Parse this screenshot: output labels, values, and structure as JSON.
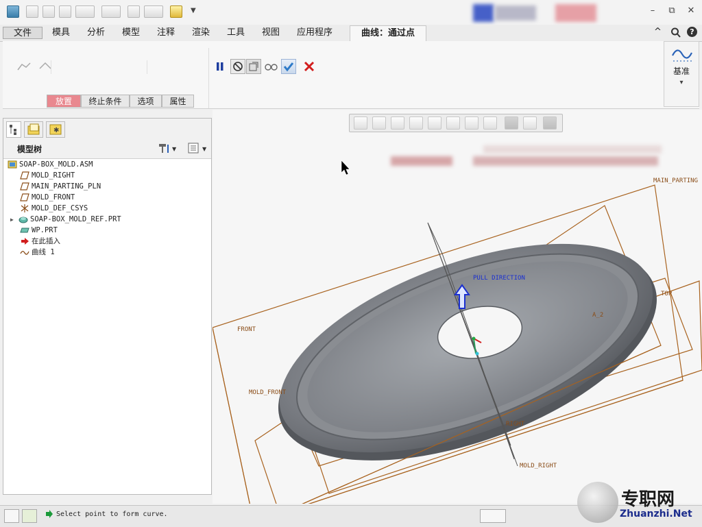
{
  "quick_access": {
    "dropdown": "▼"
  },
  "window": {
    "minimize": "–",
    "restore": "⧉",
    "close": "✕",
    "help": "?",
    "caret": "^"
  },
  "menu": {
    "file": "文件",
    "tabs": [
      "模具",
      "分析",
      "模型",
      "注释",
      "渲染",
      "工具",
      "视图",
      "应用程序"
    ],
    "context_tab": "曲线：通过点"
  },
  "dashboard": {
    "subtabs": [
      "放置",
      "终止条件",
      "选项",
      "属性"
    ],
    "active_subtab": "放置"
  },
  "datum_panel": {
    "label": "基准",
    "arrow": "▾"
  },
  "model_tree": {
    "title": "模型树",
    "items": [
      {
        "label": "SOAP-BOX_MOLD.ASM",
        "icon": "assembly-icon"
      },
      {
        "label": "MOLD_RIGHT",
        "icon": "datum-plane-icon"
      },
      {
        "label": "MAIN_PARTING_PLN",
        "icon": "datum-plane-icon"
      },
      {
        "label": "MOLD_FRONT",
        "icon": "datum-plane-icon"
      },
      {
        "label": "MOLD_DEF_CSYS",
        "icon": "csys-icon"
      },
      {
        "label": "SOAP-BOX_MOLD_REF.PRT",
        "icon": "part-icon"
      },
      {
        "label": "WP.PRT",
        "icon": "part-icon"
      },
      {
        "label": "在此插入",
        "icon": "insert-here-icon"
      },
      {
        "label": "曲线 1",
        "icon": "curve-icon"
      }
    ]
  },
  "graphics": {
    "labels": {
      "main_parting": "MAIN_PARTING",
      "pull_direction": "PULL DIRECTION",
      "top": "TOP",
      "front": "FRONT",
      "mold_front": "MOLD_FRONT",
      "right": "RIGHT",
      "mold_right": "MOLD_RIGHT",
      "a2": "A_2"
    }
  },
  "status": {
    "message": "Select point to form curve."
  },
  "watermark": {
    "text_cn": "专职网",
    "text_en": "Zhuanzhi.Net"
  },
  "colors": {
    "accent_tab": "#e9888f",
    "datum_orange": "#a8621e",
    "part_gray": "#6f7277",
    "pull_blue": "#1a2fd0"
  }
}
